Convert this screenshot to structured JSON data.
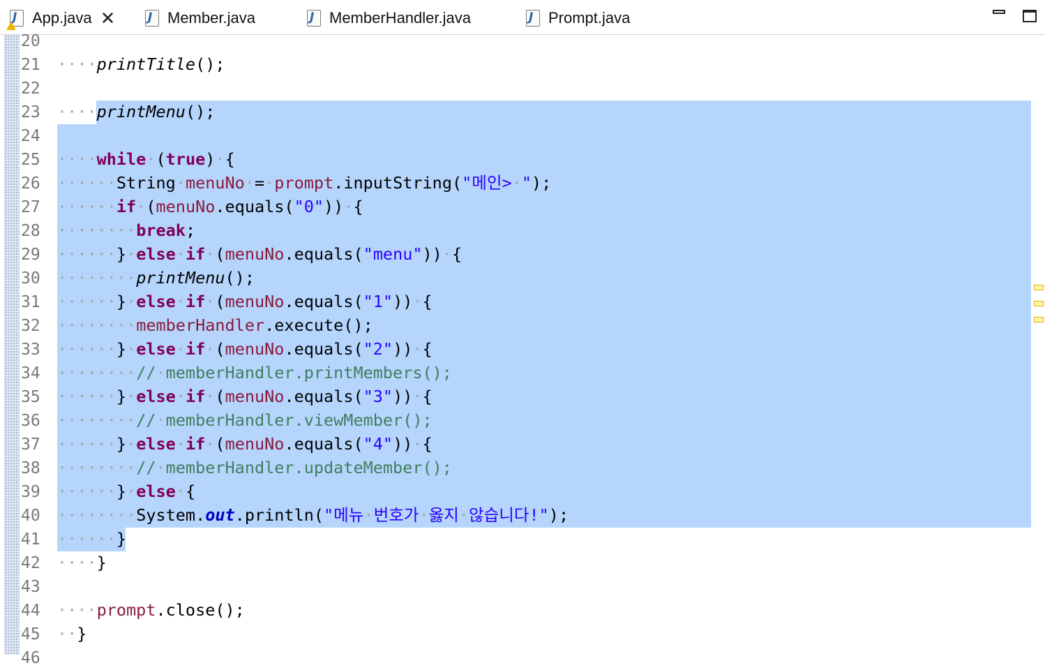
{
  "tabs": [
    {
      "label": "App.java",
      "active": true,
      "warning": true,
      "closable": true
    },
    {
      "label": "Member.java"
    },
    {
      "label": "MemberHandler.java"
    },
    {
      "label": "Prompt.java"
    }
  ],
  "gutter": {
    "line_numbers": [
      "20",
      "21",
      "22",
      "23",
      "24",
      "25",
      "26",
      "27",
      "28",
      "29",
      "30",
      "31",
      "32",
      "33",
      "34",
      "35",
      "36",
      "37",
      "38",
      "39",
      "40",
      "41",
      "42",
      "43",
      "44",
      "45",
      "46"
    ]
  },
  "editor": {
    "selection_color": "#b5d5fc",
    "lines": [
      "",
      "    printTitle();",
      "",
      "    printMenu();",
      "",
      "    while (true) {",
      "      String menuNo = prompt.inputString(\"메인> \");",
      "      if (menuNo.equals(\"0\")) {",
      "        break;",
      "      } else if (menuNo.equals(\"menu\")) {",
      "        printMenu();",
      "      } else if (menuNo.equals(\"1\")) {",
      "        memberHandler.execute();",
      "      } else if (menuNo.equals(\"2\")) {",
      "        // memberHandler.printMembers();",
      "      } else if (menuNo.equals(\"3\")) {",
      "        // memberHandler.viewMember();",
      "      } else if (menuNo.equals(\"4\")) {",
      "        // memberHandler.updateMember();",
      "      } else {",
      "        System.out.println(\"메뉴 번호가 옳지 않습니다!\");",
      "      }",
      "    }",
      "",
      "    prompt.close();",
      "  }",
      ""
    ]
  },
  "overview_ruler": {
    "marker_count": 3,
    "marker_color": "#e0b400"
  }
}
